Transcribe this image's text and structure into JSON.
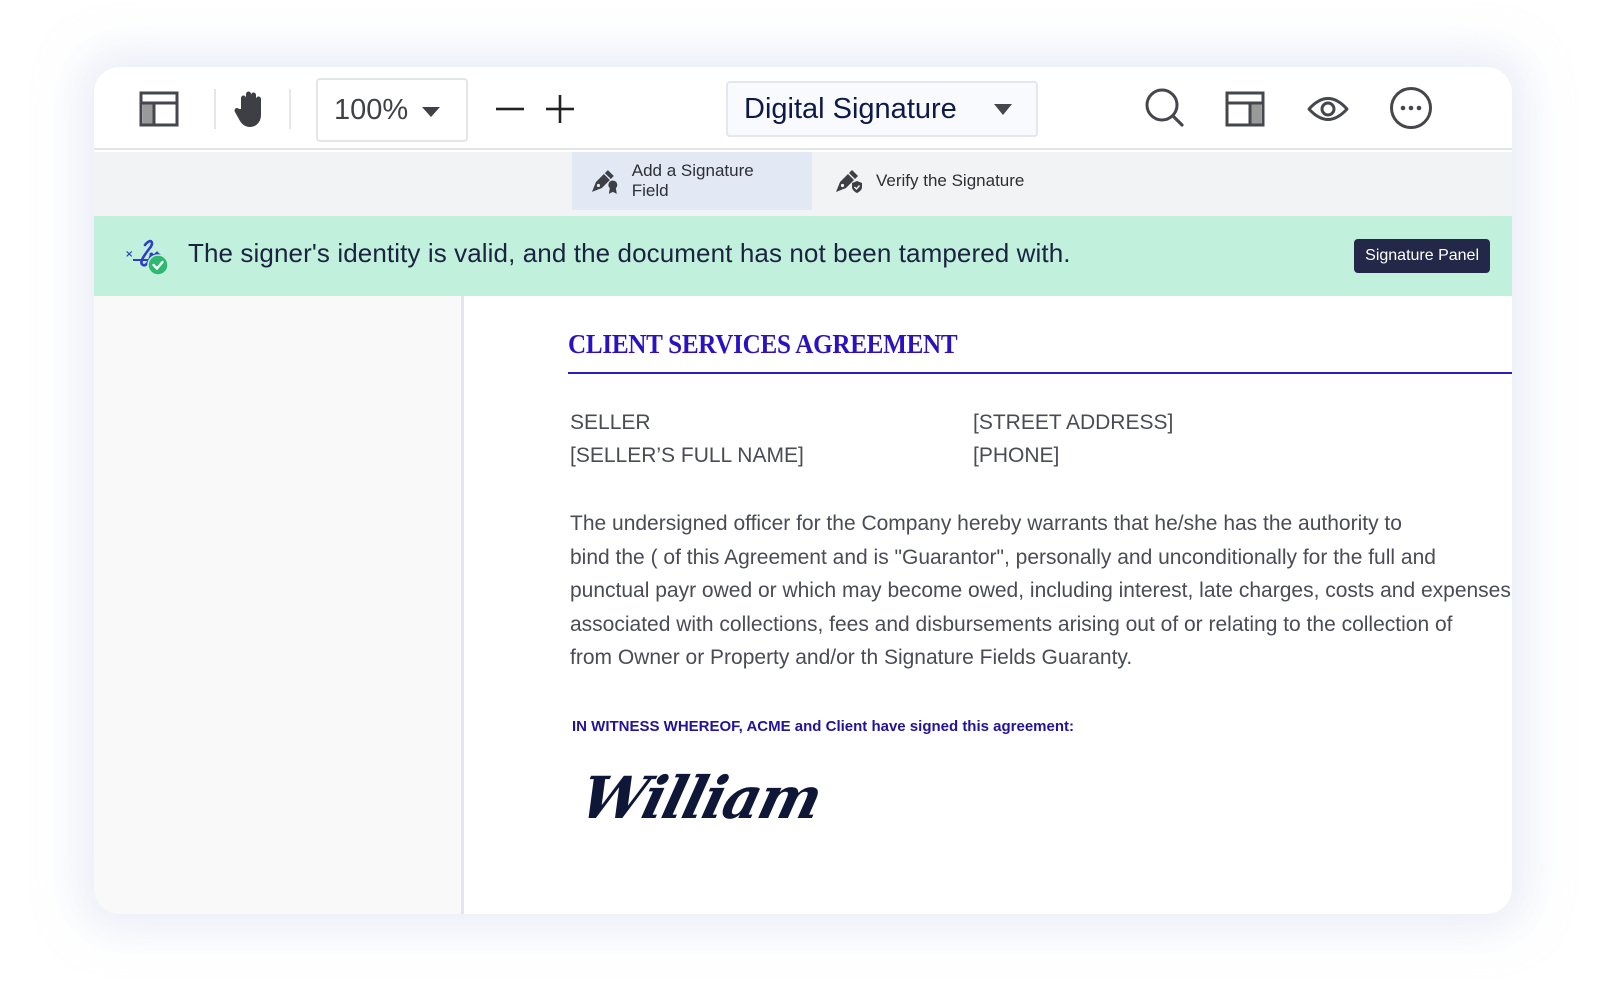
{
  "toolbar": {
    "zoom_value": "100%",
    "zoom_out_label": "−",
    "zoom_in_label": "+",
    "mode_value": "Digital Signature",
    "icons": [
      "layout-left-icon",
      "hand-pan-icon",
      "search-icon",
      "layout-right-icon",
      "eye-icon",
      "more-options-icon"
    ]
  },
  "subtoolbar": {
    "items": [
      {
        "label": "Add a Signature Field",
        "icon": "signature-field-icon",
        "active": true
      },
      {
        "label": "Verify the Signature",
        "icon": "verify-signature-icon",
        "active": false
      }
    ]
  },
  "banner": {
    "message": "The signer's identity is valid, and the document has not been tampered with.",
    "button_label": "Signature Panel",
    "icon": "signature-valid-icon",
    "bg_color": "#c1f0dc"
  },
  "document": {
    "title": "CLIENT SERVICES AGREEMENT",
    "fields": {
      "seller_label": "SELLER",
      "seller_name": "[SELLER’S FULL NAME]",
      "street_address": "[STREET ADDRESS]",
      "phone": "[PHONE]"
    },
    "paragraph_lines": [
      "The undersigned officer for the Company hereby warrants that he/she has the authority to",
      "bind the ( of this Agreement and is \"Guarantor\", personally and unconditionally for the full and",
      "punctual payr owed or which may become owed, including interest, late charges, costs and expenses",
      "associated with collections, fees and disbursements arising out of or relating to the collection of",
      "from Owner or Property and/or th Signature Fields Guaranty."
    ],
    "witness_text": "IN WITNESS WHEREOF, ACME and Client have signed this agreement:",
    "signature": "William",
    "accent_color": "#2a12c4"
  }
}
